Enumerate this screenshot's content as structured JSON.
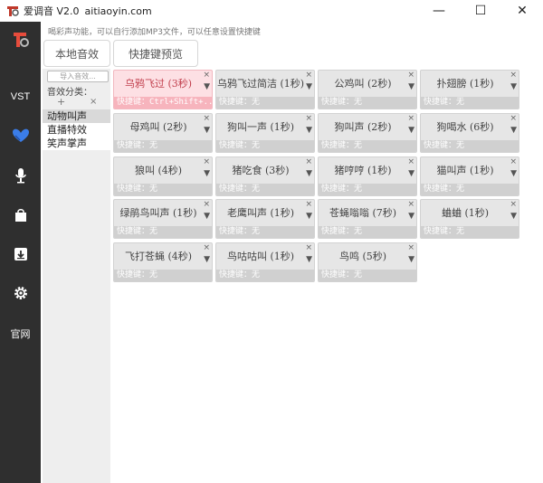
{
  "window": {
    "title": "爱调音 V2.0",
    "site": "aitiaoyin.com",
    "minimize": "—",
    "maximize": "☐",
    "close": "✕"
  },
  "sidebar": {
    "vst": "VST",
    "official": "官网"
  },
  "hint": "喝彩声功能，可以自行添加MP3文件，可以任意设置快捷键",
  "tabs": {
    "local": "本地音效",
    "preview": "快捷键预览"
  },
  "categories": {
    "import_placeholder": "导入音效...",
    "label": "音效分类：",
    "add": "+",
    "remove": "×",
    "items": [
      "动物叫声",
      "直播特效",
      "笑声掌声"
    ]
  },
  "cards": {
    "close": "×",
    "menu": "▼",
    "items": [
      {
        "name": "乌鸦飞过 (3秒)",
        "shortcut": "快捷键：Ctrl+Shift+..."
      },
      {
        "name": "乌鸦飞过简洁 (1秒)",
        "shortcut": "快捷键：无"
      },
      {
        "name": "公鸡叫 (2秒)",
        "shortcut": "快捷键：无"
      },
      {
        "name": "扑翅膀 (1秒)",
        "shortcut": "快捷键：无"
      },
      {
        "name": "母鸡叫 (2秒)",
        "shortcut": "快捷键：无"
      },
      {
        "name": "狗叫一声 (1秒)",
        "shortcut": "快捷键：无"
      },
      {
        "name": "狗叫声 (2秒)",
        "shortcut": "快捷键：无"
      },
      {
        "name": "狗喝水 (6秒)",
        "shortcut": "快捷键：无"
      },
      {
        "name": "狼叫 (4秒)",
        "shortcut": "快捷键：无"
      },
      {
        "name": "猪吃食 (3秒)",
        "shortcut": "快捷键：无"
      },
      {
        "name": "猪哼哼 (1秒)",
        "shortcut": "快捷键：无"
      },
      {
        "name": "猫叫声 (1秒)",
        "shortcut": "快捷键：无"
      },
      {
        "name": "绿鹃鸟叫声 (1秒)",
        "shortcut": "快捷键：无"
      },
      {
        "name": "老鹰叫声 (1秒)",
        "shortcut": "快捷键：无"
      },
      {
        "name": "苍蝇嗡嗡 (7秒)",
        "shortcut": "快捷键：无"
      },
      {
        "name": "蛐蛐 (1秒)",
        "shortcut": "快捷键：无"
      },
      {
        "name": "飞打苍蝇 (4秒)",
        "shortcut": "快捷键：无"
      },
      {
        "name": "鸟咕咕叫 (1秒)",
        "shortcut": "快捷键：无"
      },
      {
        "name": "鸟鸣 (5秒)",
        "shortcut": "快捷键：无"
      }
    ]
  },
  "colors": {
    "sidebar": "#2f2f2f",
    "selected_card": "#fde0e4",
    "card": "#e6e6e6"
  }
}
